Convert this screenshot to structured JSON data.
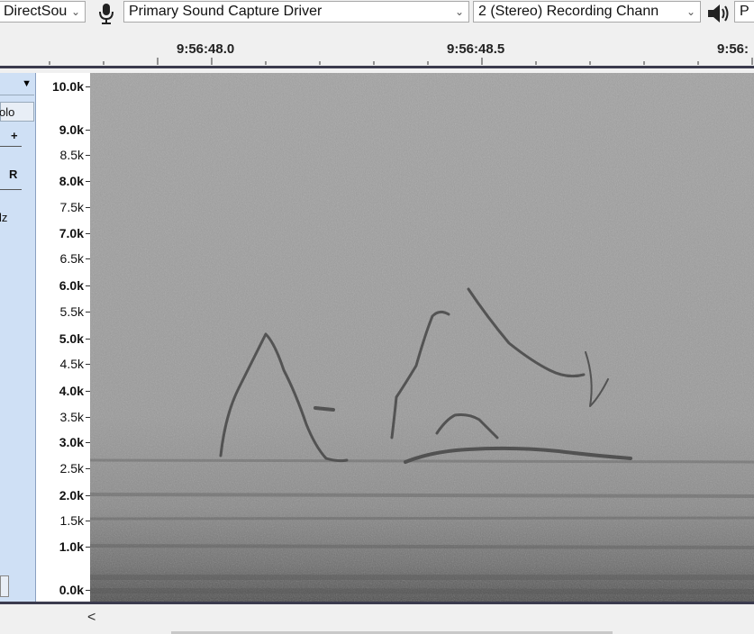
{
  "toolbar": {
    "host_value": "DirectSou",
    "device_value": "Primary Sound Capture Driver",
    "channels_value": "2 (Stereo) Recording Chann",
    "output_partial": "P"
  },
  "ruler": {
    "labels": [
      "9:56:48.0",
      "9:56:48.5",
      "9:56:"
    ]
  },
  "track_panel": {
    "solo_label": "olo",
    "gain_plus": "+",
    "pan_right": "R",
    "rate_partial": "lz"
  },
  "freq_axis": {
    "labels": [
      "10.0k",
      "9.0k",
      "8.5k",
      "8.0k",
      "7.5k",
      "7.0k",
      "6.5k",
      "6.0k",
      "5.5k",
      "5.0k",
      "4.5k",
      "4.0k",
      "3.5k",
      "3.0k",
      "2.5k",
      "2.0k",
      "1.5k",
      "1.0k",
      "0.0k"
    ]
  },
  "scrollbar": {
    "left_arrow": "<"
  },
  "colors": {
    "track_panel_bg": "#cfe0f5",
    "spectrogram_base": "#9c9c9c",
    "divider": "#3b3b4e"
  }
}
